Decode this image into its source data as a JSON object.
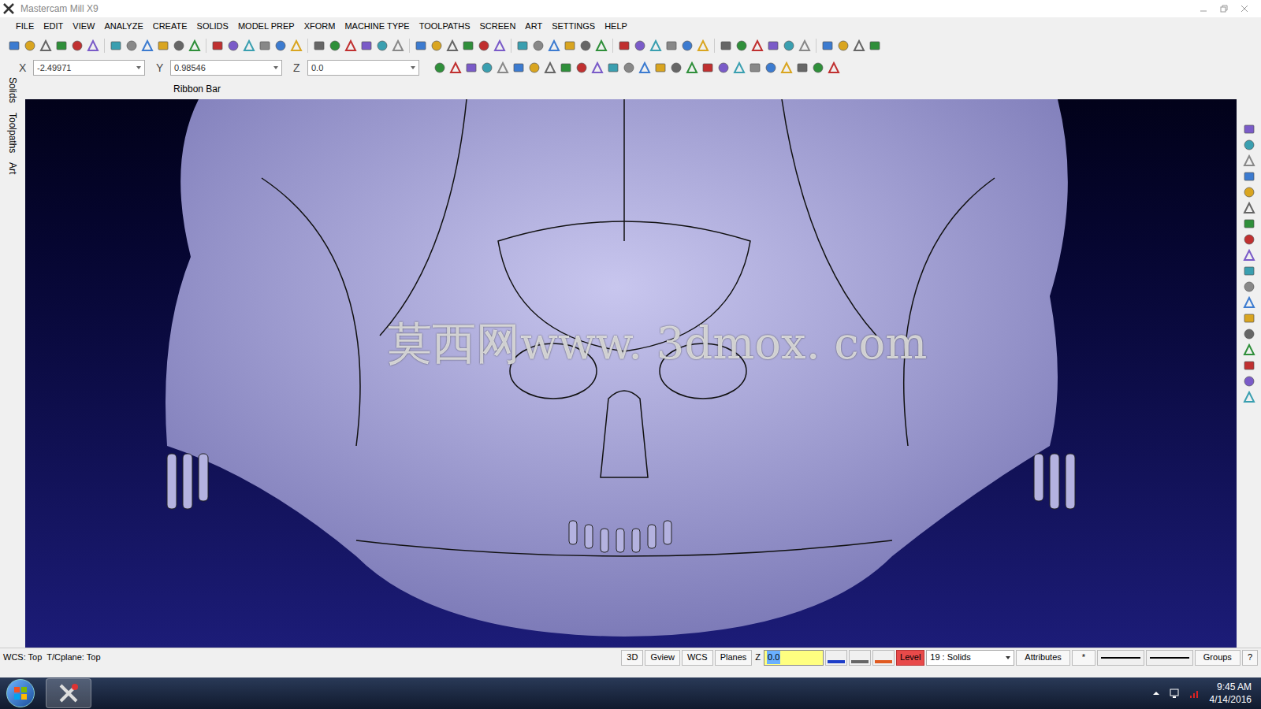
{
  "window": {
    "title": "Mastercam Mill X9"
  },
  "menu": [
    "FILE",
    "EDIT",
    "VIEW",
    "ANALYZE",
    "CREATE",
    "SOLIDS",
    "MODEL PREP",
    "XFORM",
    "MACHINE TYPE",
    "TOOLPATHS",
    "SCREEN",
    "ART",
    "SETTINGS",
    "HELP"
  ],
  "coords": [
    {
      "axis": "X",
      "value": "-2.49971"
    },
    {
      "axis": "Y",
      "value": "0.98546"
    },
    {
      "axis": "Z",
      "value": "0.0"
    }
  ],
  "ribbon_label": "Ribbon Bar",
  "side_tabs": [
    "Solids",
    "Toolpaths",
    "Art"
  ],
  "viewport": {
    "watermark": "莫西网www. 3dmox. com"
  },
  "status_bar": {
    "planes": "WCS: Top  T/Cplane: Top",
    "buttons": [
      "3D",
      "Gview",
      "WCS",
      "Planes"
    ],
    "z_label": "Z",
    "z_value": "0.0",
    "level_label": "Level",
    "level_value": "19 : Solids",
    "attributes": "Attributes",
    "star": "*",
    "groups": "Groups",
    "help": "?"
  },
  "taskbar": {
    "time": "9:45 AM",
    "date": "4/14/2016"
  }
}
